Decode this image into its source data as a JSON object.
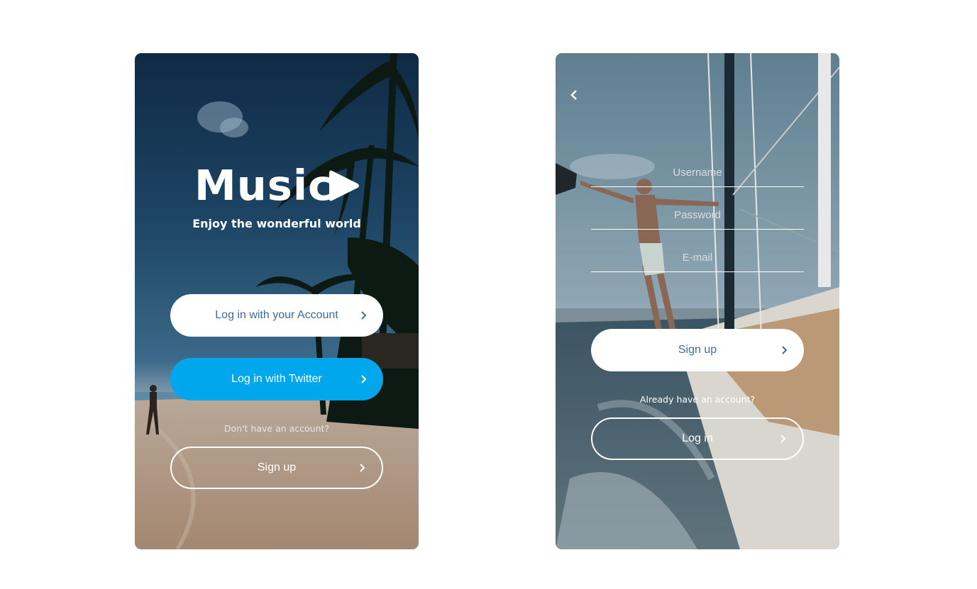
{
  "welcome_screen": {
    "brand": "Music",
    "tagline": "Enjoy the wonderful world",
    "login_account_label": "Log in with your Account",
    "login_twitter_label": "Log in with Twitter",
    "no_account_text": "Don't have an account?",
    "signup_label": "Sign up",
    "twitter_color": "#00a7ec",
    "button_text_color": "#3f6d96"
  },
  "signup_screen": {
    "username_placeholder": "Username",
    "password_placeholder": "Password",
    "email_placeholder": "E-mail",
    "signup_label": "Sign up",
    "have_account_text": "Already have an account?",
    "login_label": "Log in"
  },
  "icons": {
    "play": "play-icon",
    "chevron": "chevron-right-icon",
    "back": "chevron-left-icon"
  }
}
